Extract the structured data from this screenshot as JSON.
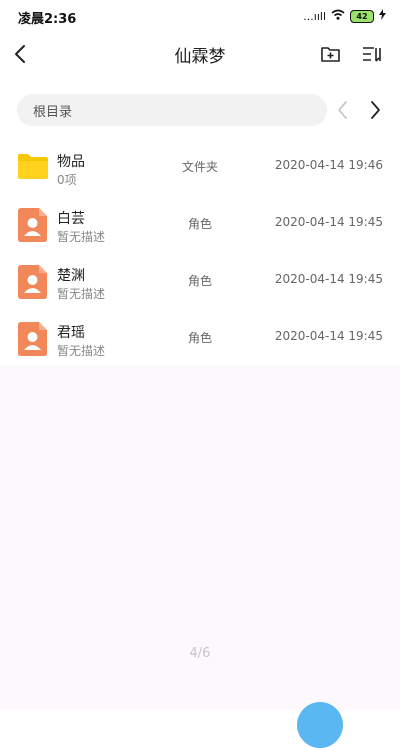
{
  "status_bar": {
    "time": "凌晨2:36",
    "signal": "...ııll",
    "battery": "42"
  },
  "header": {
    "title": "仙霖梦"
  },
  "path": {
    "placeholder": "根目录"
  },
  "items": [
    {
      "name": "物品",
      "sub": "0项",
      "type": "文件夹",
      "date": "2020-04-14 19:46",
      "icon": "folder-icon"
    },
    {
      "name": "白芸",
      "sub": "暂无描述",
      "type": "角色",
      "date": "2020-04-14 19:45",
      "icon": "character-icon"
    },
    {
      "name": "楚渊",
      "sub": "暂无描述",
      "type": "角色",
      "date": "2020-04-14 19:45",
      "icon": "character-icon"
    },
    {
      "name": "君瑶",
      "sub": "暂无描述",
      "type": "角色",
      "date": "2020-04-14 19:45",
      "icon": "character-icon"
    }
  ],
  "pagination": {
    "label": "4/6"
  },
  "colors": {
    "folder": "#f5c800",
    "character": "#f2875a",
    "fab": "#5ab7f2",
    "lower_bg": "#fcf8fc"
  }
}
